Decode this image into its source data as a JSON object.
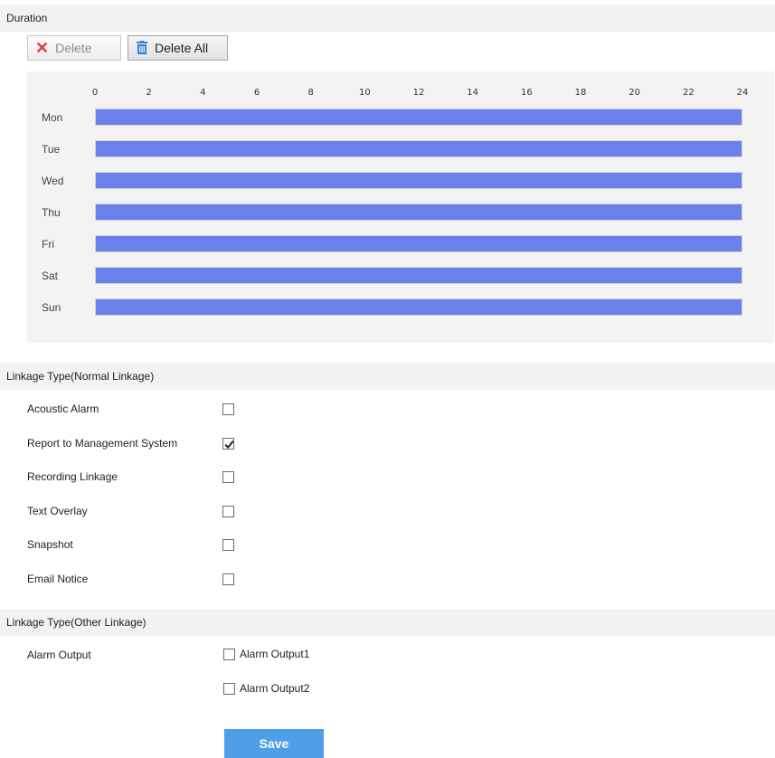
{
  "duration": {
    "title": "Duration",
    "delete_label": "Delete",
    "delete_all_label": "Delete All",
    "hours": [
      "0",
      "2",
      "4",
      "6",
      "8",
      "10",
      "12",
      "14",
      "16",
      "18",
      "20",
      "22",
      "24"
    ],
    "days": [
      {
        "label": "Mon",
        "start": 0,
        "end": 24
      },
      {
        "label": "Tue",
        "start": 0,
        "end": 24
      },
      {
        "label": "Wed",
        "start": 0,
        "end": 24
      },
      {
        "label": "Thu",
        "start": 0,
        "end": 24
      },
      {
        "label": "Fri",
        "start": 0,
        "end": 24
      },
      {
        "label": "Sat",
        "start": 0,
        "end": 24
      },
      {
        "label": "Sun",
        "start": 0,
        "end": 24
      }
    ],
    "bar_color": "#6a80eb"
  },
  "normal_linkage": {
    "title": "Linkage Type(Normal Linkage)",
    "items": [
      {
        "label": "Acoustic Alarm",
        "checked": false
      },
      {
        "label": "Report to Management System",
        "checked": true
      },
      {
        "label": "Recording Linkage",
        "checked": false
      },
      {
        "label": "Text Overlay",
        "checked": false
      },
      {
        "label": "Snapshot",
        "checked": false
      },
      {
        "label": "Email Notice",
        "checked": false
      }
    ]
  },
  "other_linkage": {
    "title": "Linkage Type(Other Linkage)",
    "alarm_output_label": "Alarm Output",
    "options": [
      {
        "label": "Alarm Output1",
        "checked": false
      },
      {
        "label": "Alarm Output2",
        "checked": false
      }
    ]
  },
  "save_label": "Save",
  "colors": {
    "accent": "#4e9ee8",
    "delete_x": "#e53935",
    "bar": "#6a80eb"
  }
}
